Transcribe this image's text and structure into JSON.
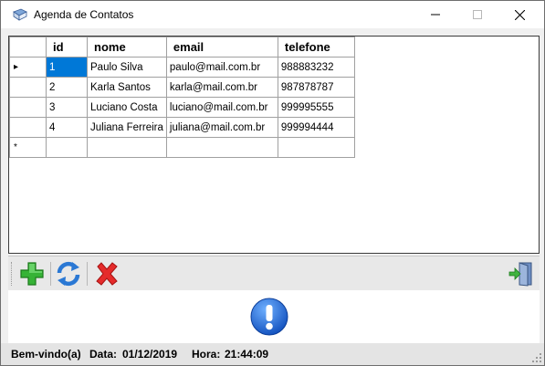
{
  "window": {
    "title": "Agenda de Contatos"
  },
  "grid": {
    "columns": [
      "id",
      "nome",
      "email",
      "telefone"
    ],
    "rows": [
      {
        "id": "1",
        "nome": "Paulo Silva",
        "email": "paulo@mail.com.br",
        "telefone": "988883232"
      },
      {
        "id": "2",
        "nome": "Karla Santos",
        "email": "karla@mail.com.br",
        "telefone": "987878787"
      },
      {
        "id": "3",
        "nome": "Luciano Costa",
        "email": "luciano@mail.com.br",
        "telefone": "999995555"
      },
      {
        "id": "4",
        "nome": "Juliana Ferreira",
        "email": "juliana@mail.com.br",
        "telefone": "999994444"
      }
    ],
    "new_row_marker": "*",
    "current_row_marker": "▸"
  },
  "toolbar": {
    "buttons": [
      {
        "name": "add-button",
        "icon": "plus-icon",
        "color": "#2fa82f"
      },
      {
        "name": "refresh-button",
        "icon": "refresh-icon",
        "color": "#2a78d4"
      },
      {
        "name": "delete-button",
        "icon": "x-icon",
        "color": "#e02020"
      },
      {
        "name": "exit-button",
        "icon": "exit-door-icon",
        "color": "#5a7bb0"
      }
    ]
  },
  "message": {
    "icon": "info-exclamation-icon",
    "color": "#1e6fd9"
  },
  "status": {
    "welcome": "Bem-vindo(a)",
    "date_label": "Data:",
    "date_value": "01/12/2019",
    "time_label": "Hora:",
    "time_value": "21:44:09"
  }
}
